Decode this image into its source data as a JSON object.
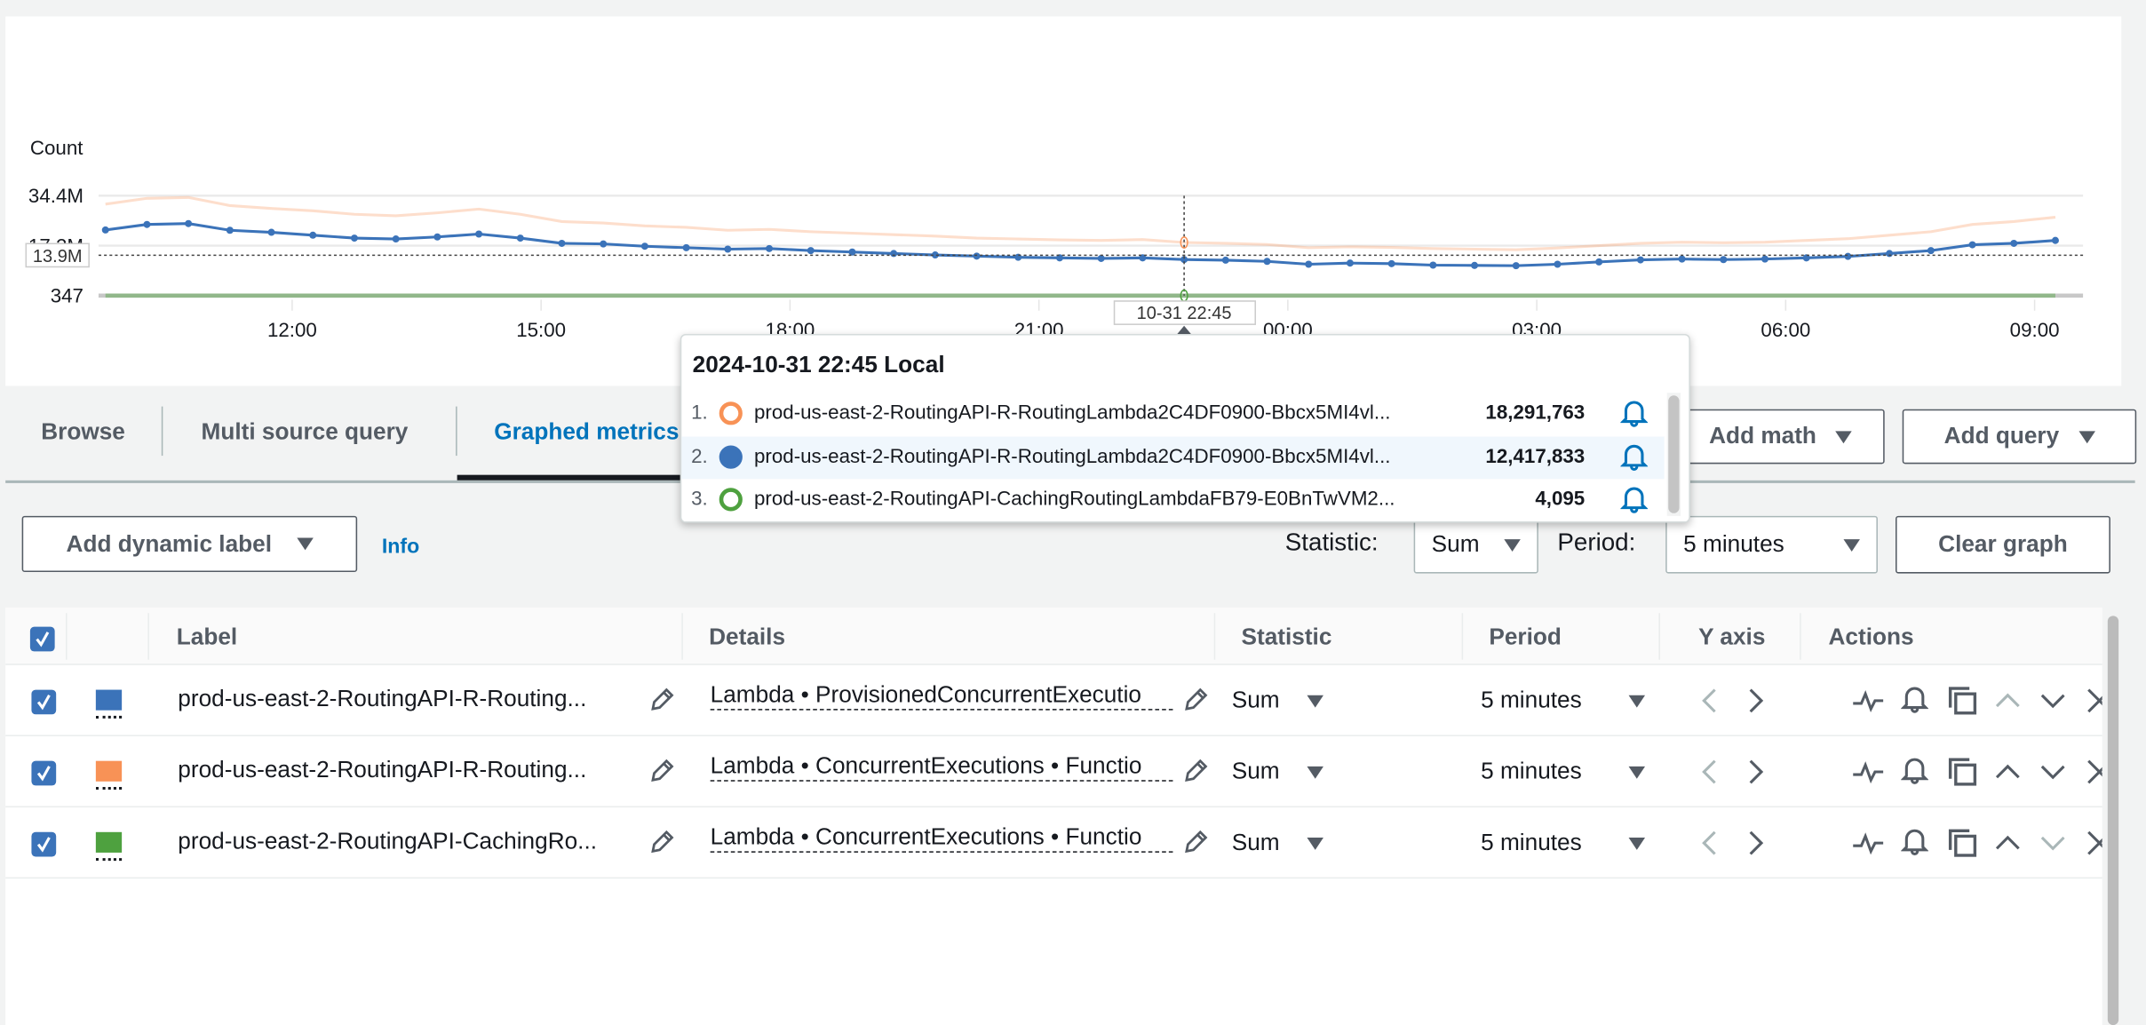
{
  "chart_data": {
    "type": "line",
    "ylabel": "Count",
    "y_ticks": [
      "34.4M",
      "17.2M",
      "347"
    ],
    "y_tick_values": [
      34400000,
      17200000,
      347
    ],
    "ylim": [
      347,
      34400000
    ],
    "x_ticks": [
      "12:00",
      "15:00",
      "18:00",
      "21:00",
      "00:00",
      "03:00",
      "06:00",
      "09:00"
    ],
    "x_tick_times": [
      "2024-10-31 12:00",
      "2024-10-31 15:00",
      "2024-10-31 18:00",
      "2024-10-31 21:00",
      "2024-11-01 00:00",
      "2024-11-01 03:00",
      "2024-11-01 06:00",
      "2024-11-01 09:00"
    ],
    "xlim": [
      "2024-10-31 09:40",
      "2024-11-01 09:35"
    ],
    "grid": true,
    "threshold": {
      "label": "13.9M",
      "value": 13900000
    },
    "crosshair": {
      "label": "10-31 22:45",
      "time": "2024-10-31 22:45"
    },
    "x": [
      "2024-10-31 09:45",
      "2024-10-31 10:15",
      "2024-10-31 10:45",
      "2024-10-31 11:15",
      "2024-10-31 11:45",
      "2024-10-31 12:15",
      "2024-10-31 12:45",
      "2024-10-31 13:15",
      "2024-10-31 13:45",
      "2024-10-31 14:15",
      "2024-10-31 14:45",
      "2024-10-31 15:15",
      "2024-10-31 15:45",
      "2024-10-31 16:15",
      "2024-10-31 16:45",
      "2024-10-31 17:15",
      "2024-10-31 17:45",
      "2024-10-31 18:15",
      "2024-10-31 18:45",
      "2024-10-31 19:15",
      "2024-10-31 19:45",
      "2024-10-31 20:15",
      "2024-10-31 20:45",
      "2024-10-31 21:15",
      "2024-10-31 21:45",
      "2024-10-31 22:15",
      "2024-10-31 22:45",
      "2024-10-31 23:15",
      "2024-10-31 23:45",
      "2024-11-01 00:15",
      "2024-11-01 00:45",
      "2024-11-01 01:15",
      "2024-11-01 01:45",
      "2024-11-01 02:15",
      "2024-11-01 02:45",
      "2024-11-01 03:15",
      "2024-11-01 03:45",
      "2024-11-01 04:15",
      "2024-11-01 04:45",
      "2024-11-01 05:15",
      "2024-11-01 05:45",
      "2024-11-01 06:15",
      "2024-11-01 06:45",
      "2024-11-01 07:15",
      "2024-11-01 07:45",
      "2024-11-01 08:15",
      "2024-11-01 08:45",
      "2024-11-01 09:15"
    ],
    "series": [
      {
        "color": "#f89256",
        "style": "faded-line",
        "values": [
          31500000,
          33500000,
          33800000,
          31000000,
          30000000,
          29200000,
          28000000,
          27500000,
          28500000,
          29800000,
          28000000,
          25500000,
          25000000,
          24000000,
          23500000,
          22500000,
          22800000,
          22000000,
          21500000,
          21000000,
          20500000,
          19800000,
          19500000,
          19200000,
          19000000,
          19300000,
          18291763,
          18000000,
          17600000,
          16500000,
          16800000,
          16600000,
          16200000,
          16000000,
          15800000,
          16400000,
          17200000,
          18000000,
          18400000,
          18200000,
          18400000,
          19000000,
          19600000,
          20800000,
          22000000,
          24500000,
          25500000,
          27000000
        ]
      },
      {
        "color": "#3b73b9",
        "style": "line-with-dots",
        "values": [
          22600000,
          24500000,
          24800000,
          22500000,
          21800000,
          20800000,
          19800000,
          19500000,
          20200000,
          21200000,
          19800000,
          18000000,
          17800000,
          17000000,
          16500000,
          16000000,
          16200000,
          15500000,
          15000000,
          14500000,
          14000000,
          13600000,
          13200000,
          13000000,
          12800000,
          13000000,
          12417833,
          12200000,
          11800000,
          10800000,
          11200000,
          11000000,
          10500000,
          10400000,
          10300000,
          10800000,
          11600000,
          12300000,
          12600000,
          12400000,
          12600000,
          13000000,
          13500000,
          14500000,
          15500000,
          17500000,
          18000000,
          19000000
        ]
      },
      {
        "color": "#4ea13f",
        "style": "line",
        "values": [
          4100,
          4080,
          4090,
          4100,
          4095,
          4090,
          4100,
          4085,
          4095,
          4100,
          4090,
          4095,
          4100,
          4090,
          4095,
          4100,
          4090,
          4095,
          4100,
          4090,
          4095,
          4100,
          4090,
          4095,
          4100,
          4090,
          4095,
          4100,
          4090,
          4095,
          4100,
          4090,
          4095,
          4100,
          4090,
          4095,
          4100,
          4090,
          4095,
          4100,
          4090,
          4095,
          4100,
          4090,
          4095,
          4100,
          4090,
          4095
        ]
      }
    ]
  },
  "tooltip": {
    "title": "2024-10-31 22:45 Local",
    "rows": [
      {
        "index": "1.",
        "marker": "hollow-circle",
        "color": "#f89256",
        "label": "prod-us-east-2-RoutingAPI-R-RoutingLambda2C4DF0900-Bbcx5MI4vl...",
        "value": "18,291,763",
        "icon": "bell-icon"
      },
      {
        "index": "2.",
        "marker": "filled-circle",
        "color": "#3b73b9",
        "label": "prod-us-east-2-RoutingAPI-R-RoutingLambda2C4DF0900-Bbcx5MI4vl...",
        "value": "12,417,833",
        "icon": "bell-icon"
      },
      {
        "index": "3.",
        "marker": "hollow-circle",
        "color": "#4ea13f",
        "label": "prod-us-east-2-RoutingAPI-CachingRoutingLambdaFB79-E0BnTwVM2...",
        "value": "4,095",
        "icon": "bell-icon"
      }
    ]
  },
  "tabs": [
    {
      "label": "Browse",
      "active": false
    },
    {
      "label": "Multi source query",
      "active": false
    },
    {
      "label": "Graphed metrics",
      "active": true
    }
  ],
  "toolbar": {
    "add_math": "Add math",
    "add_query": "Add query",
    "add_dynamic_label": "Add dynamic label",
    "info": "Info",
    "statistic_label": "Statistic:",
    "statistic_value": "Sum",
    "period_label": "Period:",
    "period_value": "5 minutes",
    "clear_graph": "Clear graph"
  },
  "table": {
    "headers": {
      "label": "Label",
      "details": "Details",
      "statistic": "Statistic",
      "period": "Period",
      "y_axis": "Y axis",
      "actions": "Actions"
    },
    "rows": [
      {
        "checked": true,
        "color": "#3b73b9",
        "label": "prod-us-east-2-RoutingAPI-R-Routing...",
        "details": "Lambda • ProvisionedConcurrentExecutio",
        "statistic": "Sum",
        "period": "5 minutes",
        "move_up_enabled": false,
        "move_down_enabled": true
      },
      {
        "checked": true,
        "color": "#f89256",
        "label": "prod-us-east-2-RoutingAPI-R-Routing...",
        "details": "Lambda • ConcurrentExecutions • Functio",
        "statistic": "Sum",
        "period": "5 minutes",
        "move_up_enabled": true,
        "move_down_enabled": true
      },
      {
        "checked": true,
        "color": "#4ea13f",
        "label": "prod-us-east-2-RoutingAPI-CachingRo...",
        "details": "Lambda • ConcurrentExecutions • Functio",
        "statistic": "Sum",
        "period": "5 minutes",
        "move_up_enabled": true,
        "move_down_enabled": false
      }
    ]
  },
  "colors": {
    "accent": "#0073bb",
    "active_tab_underline": "#16191f"
  }
}
